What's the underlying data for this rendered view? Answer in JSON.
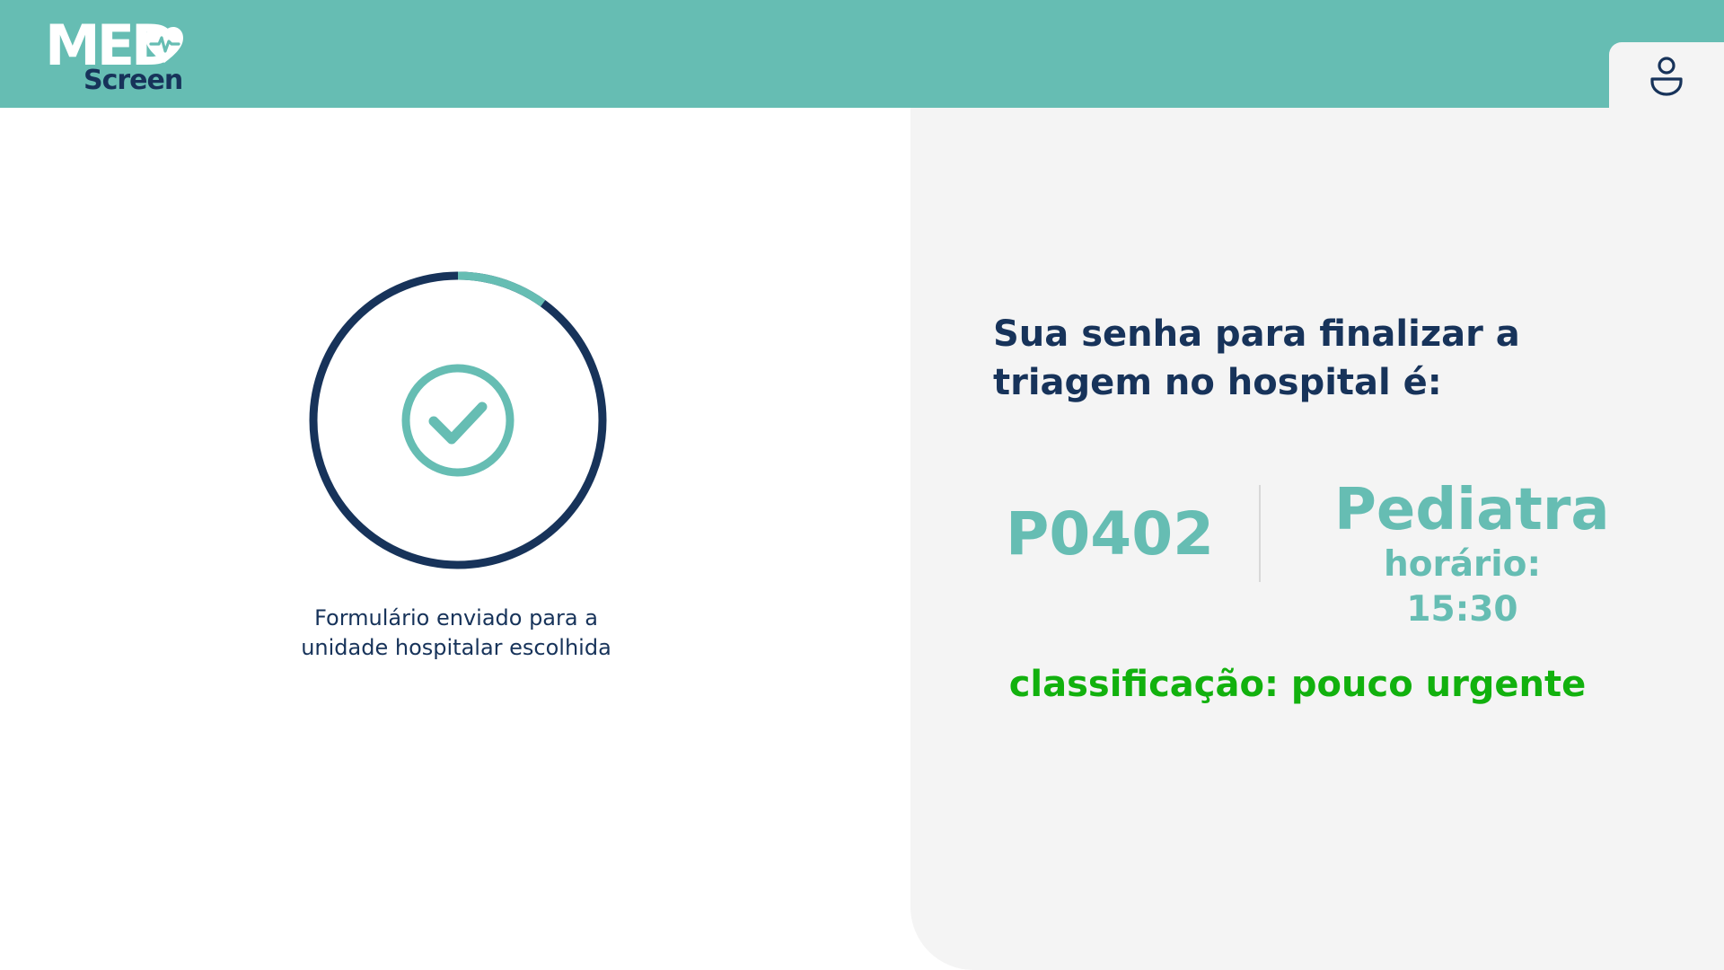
{
  "header": {
    "logo_top": "MED",
    "logo_bottom": "Screen"
  },
  "icons": {
    "user": "user-icon",
    "check": "check-circle-icon",
    "heart": "heart-pulse-icon"
  },
  "colors": {
    "header_bg": "#66bdb3",
    "navy": "#17335a",
    "teal": "#66bdb3",
    "urgency_green": "#12b10e",
    "panel_bg": "#f4f4f4"
  },
  "status": {
    "message": "Formulário enviado para a unidade hospitalar escolhida",
    "progress_teal_fraction": 0.1
  },
  "ticket": {
    "instruction": "Sua senha para finalizar a triagem no hospital é:",
    "code": "P0402",
    "specialty": "Pediatra",
    "schedule": "horário: 15:30",
    "classification": "classificação: pouco urgente"
  }
}
